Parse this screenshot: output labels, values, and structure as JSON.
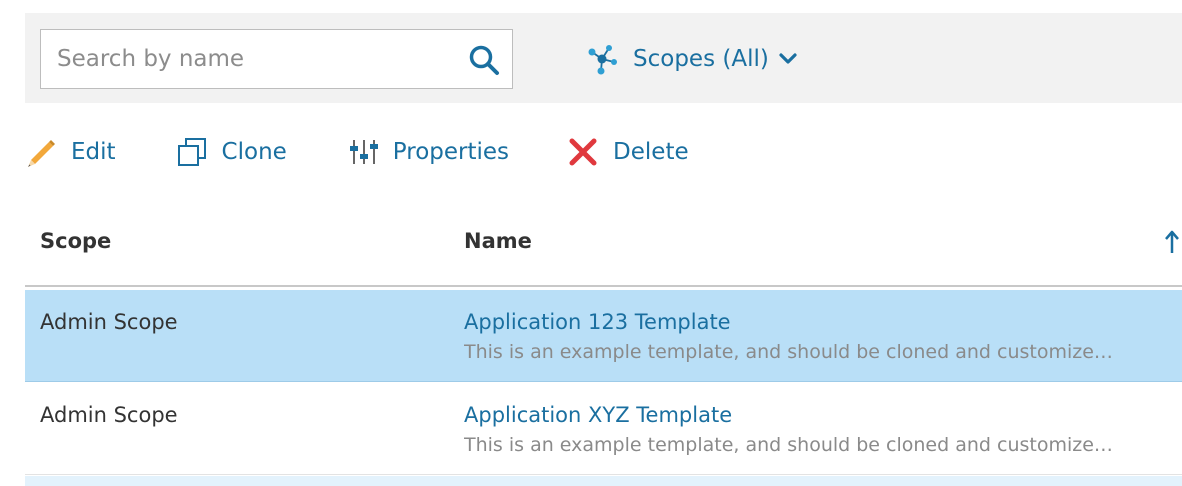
{
  "search": {
    "placeholder": "Search by name",
    "value": "",
    "icon": "search-icon"
  },
  "scopes_filter": {
    "label": "Scopes (All)",
    "icon": "scopes-network-icon"
  },
  "toolbar": {
    "edit_label": "Edit",
    "clone_label": "Clone",
    "properties_label": "Properties",
    "delete_label": "Delete"
  },
  "table": {
    "columns": [
      "Scope",
      "Name"
    ],
    "sort": "ascending",
    "rows": [
      {
        "scope": "Admin Scope",
        "name": "Application 123 Template",
        "description": "This is an example template, and should be cloned and customize…",
        "selected": true
      },
      {
        "scope": "Admin Scope",
        "name": "Application XYZ Template",
        "description": "This is an example template, and should be cloned and customize…",
        "selected": false
      }
    ]
  },
  "colors": {
    "accent": "#1a6fa0",
    "selected_row": "#b9dff7",
    "delete_red": "#e0393e",
    "edit_pencil": "#f2a83b",
    "bar_bg": "#f2f2f2"
  }
}
